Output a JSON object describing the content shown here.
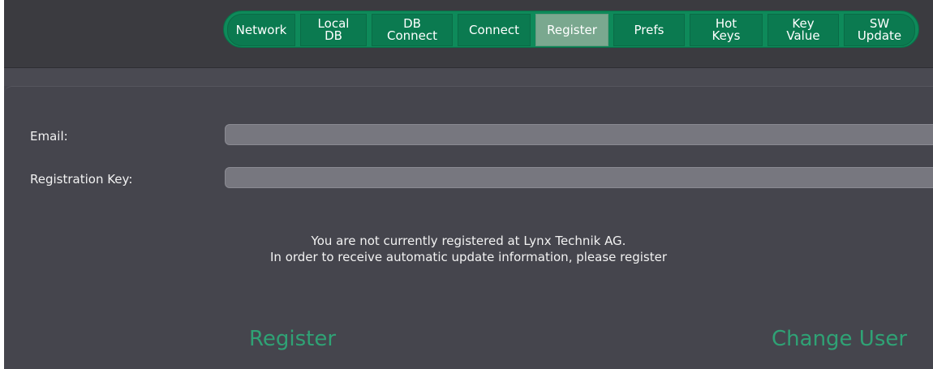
{
  "tabs": [
    {
      "label": "Network",
      "active": false
    },
    {
      "label": "Local\nDB",
      "active": false
    },
    {
      "label": "DB\nConnect",
      "active": false
    },
    {
      "label": "Connect",
      "active": false
    },
    {
      "label": "Register",
      "active": true
    },
    {
      "label": "Prefs",
      "active": false
    },
    {
      "label": "Hot\nKeys",
      "active": false
    },
    {
      "label": "Key\nValue",
      "active": false
    },
    {
      "label": "SW\nUpdate",
      "active": false
    }
  ],
  "form": {
    "email_label": "Email:",
    "email_value": "",
    "key_label": "Registration Key:",
    "key_value": ""
  },
  "message": {
    "line1": "You are not currently registered at Lynx Technik AG.",
    "line2": "In order to receive automatic update information, please register"
  },
  "actions": {
    "register_label": "Register",
    "change_user_label": "Change User"
  },
  "colors": {
    "tab_green": "#0b7a50",
    "tab_active": "#7aa88f",
    "action_green": "#2fa275",
    "panel_bg": "#45454d"
  }
}
